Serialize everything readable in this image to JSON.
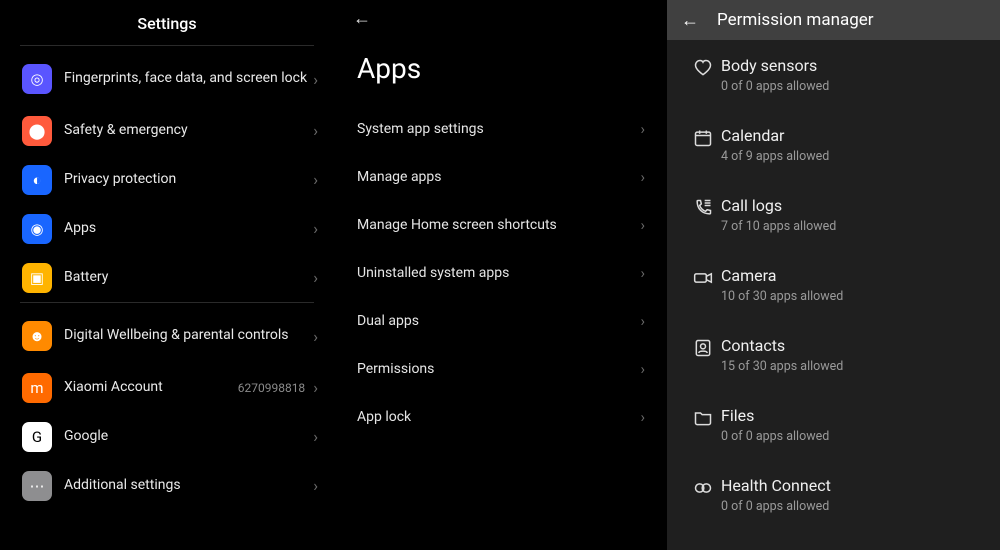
{
  "panel1": {
    "title": "Settings",
    "groups": [
      [
        {
          "label": "Fingerprints, face data, and screen lock",
          "icon": "fingerprint-icon",
          "iconClass": "ic-fp",
          "glyph": "◎",
          "tall": true
        },
        {
          "label": "Safety & emergency",
          "icon": "safety-icon",
          "iconClass": "ic-safety",
          "glyph": "⬤"
        },
        {
          "label": "Privacy protection",
          "icon": "privacy-icon",
          "iconClass": "ic-privacy",
          "glyph": "◐"
        },
        {
          "label": "Apps",
          "icon": "apps-icon",
          "iconClass": "ic-apps",
          "glyph": "◉"
        },
        {
          "label": "Battery",
          "icon": "battery-icon",
          "iconClass": "ic-batt",
          "glyph": "▣"
        }
      ],
      [
        {
          "label": "Digital Wellbeing & parental controls",
          "icon": "wellbeing-icon",
          "iconClass": "ic-dw",
          "glyph": "☻",
          "tall": true
        },
        {
          "label": "Xiaomi Account",
          "icon": "xiaomi-icon",
          "iconClass": "ic-xiaomi",
          "glyph": "m",
          "sub": "6270998818"
        },
        {
          "label": "Google",
          "icon": "google-icon",
          "iconClass": "ic-google",
          "glyph": "G"
        },
        {
          "label": "Additional settings",
          "icon": "additional-icon",
          "iconClass": "ic-more",
          "glyph": "⋯"
        }
      ]
    ]
  },
  "panel2": {
    "heading": "Apps",
    "items": [
      "System app settings",
      "Manage apps",
      "Manage Home screen shortcuts",
      "Uninstalled system apps",
      "Dual apps",
      "Permissions",
      "App lock"
    ]
  },
  "panel3": {
    "title": "Permission manager",
    "items": [
      {
        "label": "Body sensors",
        "sub": "0 of 0 apps allowed",
        "icon": "heart"
      },
      {
        "label": "Calendar",
        "sub": "4 of 9 apps allowed",
        "icon": "calendar"
      },
      {
        "label": "Call logs",
        "sub": "7 of 10 apps allowed",
        "icon": "phonelist"
      },
      {
        "label": "Camera",
        "sub": "10 of 30 apps allowed",
        "icon": "camera"
      },
      {
        "label": "Contacts",
        "sub": "15 of 30 apps allowed",
        "icon": "contacts"
      },
      {
        "label": "Files",
        "sub": "0 of 0 apps allowed",
        "icon": "folder"
      },
      {
        "label": "Health Connect",
        "sub": "0 of 0 apps allowed",
        "icon": "health"
      }
    ]
  }
}
